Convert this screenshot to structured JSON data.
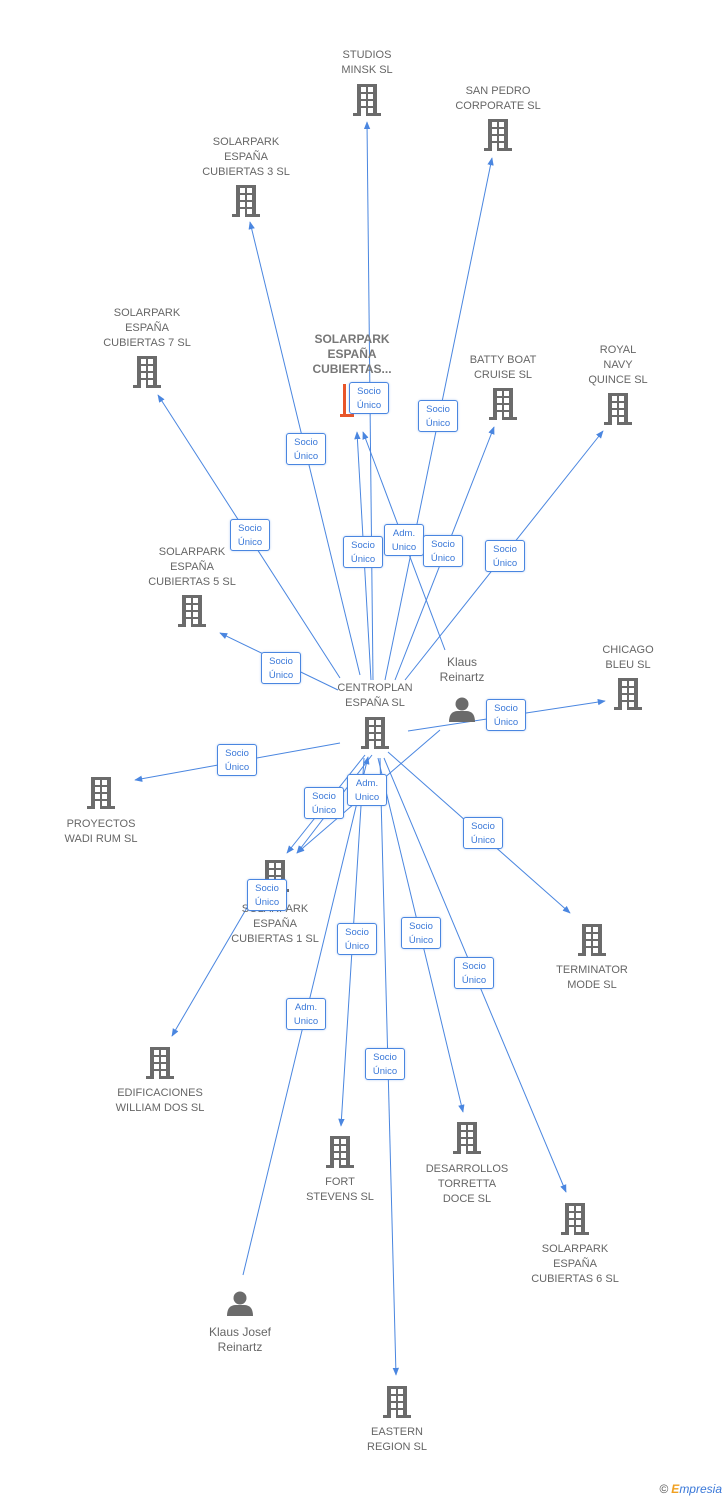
{
  "colors": {
    "edge": "#4a86e0",
    "icon": "#6b6b6b",
    "focus_icon": "#e8562a"
  },
  "nodes": [
    {
      "id": "studios",
      "type": "company",
      "label": [
        "STUDIOS",
        "MINSK SL"
      ]
    },
    {
      "id": "sanpedro",
      "type": "company",
      "label": [
        "SAN PEDRO",
        "CORPORATE SL"
      ]
    },
    {
      "id": "c3",
      "type": "company",
      "label": [
        "SOLARPARK",
        "ESPAÑA",
        "CUBIERTAS 3 SL"
      ]
    },
    {
      "id": "c7",
      "type": "company",
      "label": [
        "SOLARPARK",
        "ESPAÑA",
        "CUBIERTAS 7 SL"
      ]
    },
    {
      "id": "focus",
      "type": "focus",
      "label": [
        "SOLARPARK",
        "ESPAÑA",
        "CUBIERTAS..."
      ]
    },
    {
      "id": "batty",
      "type": "company",
      "label": [
        "BATTY BOAT",
        "CRUISE SL"
      ]
    },
    {
      "id": "royal",
      "type": "company",
      "label": [
        "ROYAL",
        "NAVY",
        "QUINCE SL"
      ]
    },
    {
      "id": "c5",
      "type": "company",
      "label": [
        "SOLARPARK",
        "ESPAÑA",
        "CUBIERTAS 5 SL"
      ]
    },
    {
      "id": "centroplan",
      "type": "company",
      "label": [
        "CENTROPLAN",
        "ESPAÑA SL"
      ]
    },
    {
      "id": "klaus",
      "type": "person",
      "label": [
        "Klaus",
        "Reinartz"
      ]
    },
    {
      "id": "chicago",
      "type": "company",
      "label": [
        "CHICAGO",
        "BLEU SL"
      ]
    },
    {
      "id": "wadi",
      "type": "company",
      "label": [
        "PROYECTOS",
        "WADI RUM SL"
      ]
    },
    {
      "id": "c1",
      "type": "company",
      "label": [
        "SOLARPARK",
        "ESPAÑA",
        "CUBIERTAS 1  SL"
      ]
    },
    {
      "id": "terminator",
      "type": "company",
      "label": [
        "TERMINATOR",
        "MODE SL"
      ]
    },
    {
      "id": "edificaciones",
      "type": "company",
      "label": [
        "EDIFICACIONES",
        "WILLIAM DOS SL"
      ]
    },
    {
      "id": "fort",
      "type": "company",
      "label": [
        "FORT",
        "STEVENS SL"
      ]
    },
    {
      "id": "desarrollos",
      "type": "company",
      "label": [
        "DESARROLLOS",
        "TORRETTA",
        "DOCE SL"
      ]
    },
    {
      "id": "c6",
      "type": "company",
      "label": [
        "SOLARPARK",
        "ESPAÑA",
        "CUBIERTAS 6 SL"
      ]
    },
    {
      "id": "klausjosef",
      "type": "person",
      "label": [
        "Klaus Josef",
        "Reinartz"
      ]
    },
    {
      "id": "eastern",
      "type": "company",
      "label": [
        "EASTERN",
        "REGION SL"
      ]
    }
  ],
  "edge_labels": [
    [
      "Socio",
      "Único"
    ],
    [
      "Socio",
      "Único"
    ],
    [
      "Socio",
      "Único"
    ],
    [
      "Socio",
      "Único"
    ],
    [
      "Socio",
      "Único"
    ],
    [
      "Adm.",
      "Unico"
    ],
    [
      "Socio",
      "Único"
    ],
    [
      "Socio",
      "Único"
    ],
    [
      "Socio",
      "Único"
    ],
    [
      "Socio",
      "Único"
    ],
    [
      "Socio",
      "Único"
    ],
    [
      "Socio",
      "Único"
    ],
    [
      "Adm.",
      "Unico"
    ],
    [
      "Socio",
      "Único"
    ],
    [
      "Socio",
      "Único"
    ],
    [
      "Socio",
      "Único"
    ],
    [
      "Socio",
      "Único"
    ],
    [
      "Socio",
      "Único"
    ],
    [
      "Adm.",
      "Unico"
    ],
    [
      "Socio",
      "Único"
    ]
  ],
  "footer": {
    "copyright": "©",
    "brand_initial": "E",
    "brand_rest": "mpresia"
  }
}
